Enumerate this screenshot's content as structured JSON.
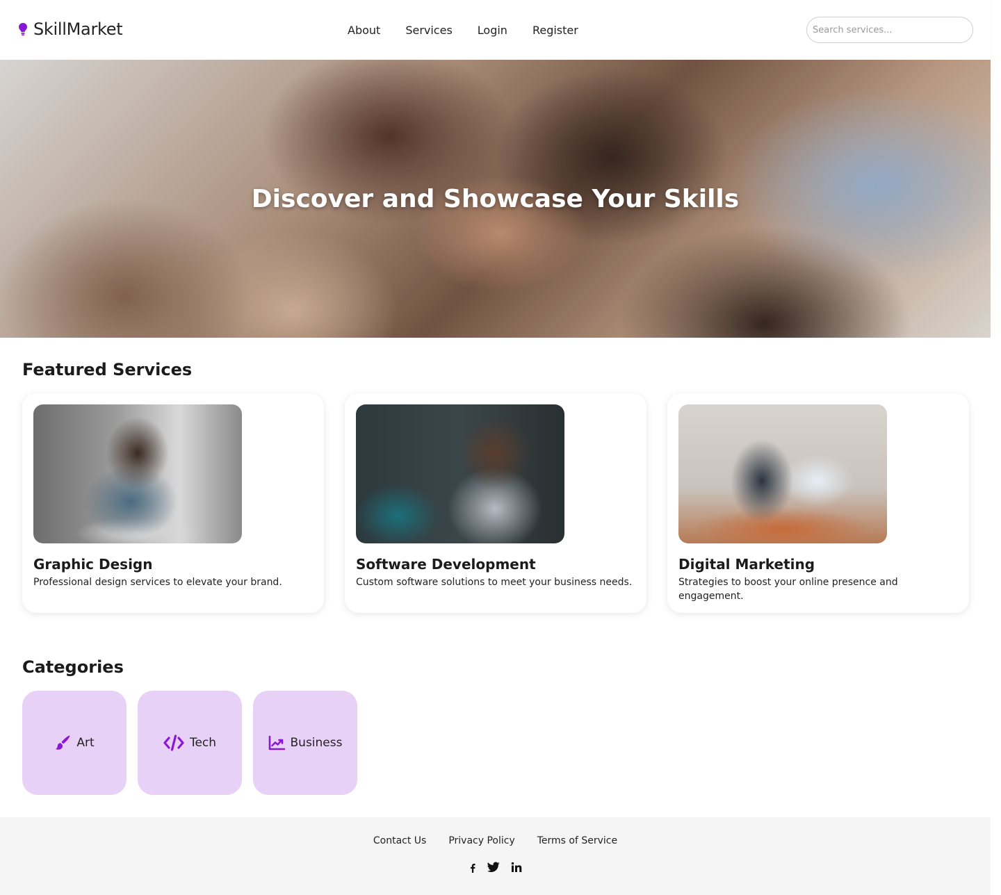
{
  "brand": {
    "name": "SkillMarket",
    "icon": "lightbulb-icon",
    "accent": "#8a17d6"
  },
  "nav": {
    "items": [
      "About",
      "Services",
      "Login",
      "Register"
    ]
  },
  "search": {
    "placeholder": "Search services..."
  },
  "hero": {
    "title": "Discover and Showcase Your Skills"
  },
  "featured": {
    "title": "Featured Services",
    "cards": [
      {
        "title": "Graphic Design",
        "desc": "Professional design services to elevate your brand."
      },
      {
        "title": "Software Development",
        "desc": "Custom software solutions to meet your business needs."
      },
      {
        "title": "Digital Marketing",
        "desc": "Strategies to boost your online presence and engagement."
      }
    ]
  },
  "categories": {
    "title": "Categories",
    "items": [
      {
        "label": "Art",
        "icon": "paintbrush-icon"
      },
      {
        "label": "Tech",
        "icon": "code-icon"
      },
      {
        "label": "Business",
        "icon": "chart-line-icon"
      }
    ],
    "tile_color": "#e8d1f7"
  },
  "footer": {
    "links": [
      "Contact Us",
      "Privacy Policy",
      "Terms of Service"
    ],
    "social": [
      "facebook-icon",
      "twitter-icon",
      "linkedin-icon"
    ]
  }
}
